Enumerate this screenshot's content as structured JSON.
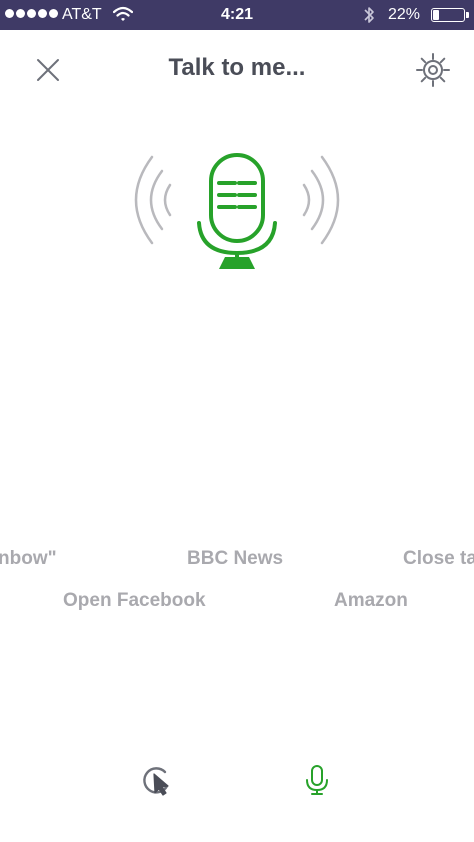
{
  "status_bar": {
    "carrier": "AT&T",
    "time": "4:21",
    "battery_percent": "22%",
    "battery_level": 0.22,
    "signal_dots": 5,
    "wifi_icon": "wifi-icon",
    "bluetooth_icon": "bluetooth-icon"
  },
  "header": {
    "title": "Talk to me...",
    "close_icon": "close-icon",
    "settings_icon": "gear-icon"
  },
  "hero": {
    "icon": "microphone-icon",
    "accent_color": "#27a22a",
    "wave_color": "#b9b9bd"
  },
  "suggestions": [
    {
      "label": "nbow\""
    },
    {
      "label": "BBC News"
    },
    {
      "label": "Close ta"
    },
    {
      "label": "Open Facebook"
    },
    {
      "label": "Amazon"
    }
  ],
  "bottom_bar": {
    "tap_icon": "tap-gesture-icon",
    "mic_icon": "microphone-icon"
  }
}
